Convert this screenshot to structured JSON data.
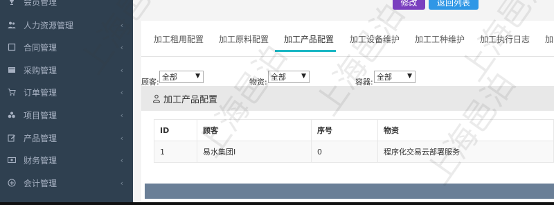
{
  "sidebar": {
    "items": [
      {
        "label": "会员管理",
        "icon": "trophy-icon"
      },
      {
        "label": "人力资源管理",
        "icon": "users-icon"
      },
      {
        "label": "合同管理",
        "icon": "contract-icon"
      },
      {
        "label": "采购管理",
        "icon": "purchase-icon"
      },
      {
        "label": "订单管理",
        "icon": "cart-icon"
      },
      {
        "label": "项目管理",
        "icon": "project-icon"
      },
      {
        "label": "产品管理",
        "icon": "edit-icon"
      },
      {
        "label": "财务管理",
        "icon": "money-icon"
      },
      {
        "label": "会计管理",
        "icon": "accounting-icon"
      }
    ],
    "chevron": "‹"
  },
  "toolbar": {
    "btn1_label": "修改",
    "btn2_label": "返回列表"
  },
  "tabs": [
    {
      "label": "加工租用配置"
    },
    {
      "label": "加工原料配置"
    },
    {
      "label": "加工产品配置",
      "active": true
    },
    {
      "label": "加工设备维护"
    },
    {
      "label": "加工工种维护"
    },
    {
      "label": "加工执行日志"
    },
    {
      "label": "加"
    }
  ],
  "filters": {
    "customer_label": "顾客:",
    "customer_value": "全部",
    "material_label": "物资:",
    "material_value": "全部",
    "container_label": "容器:",
    "container_value": "全部"
  },
  "section": {
    "title": "加工产品配置"
  },
  "table": {
    "headers": [
      "ID",
      "顾客",
      "序号",
      "物资"
    ],
    "rows": [
      [
        "1",
        "易水集团I",
        "0",
        "程序化交易云部署服务"
      ]
    ]
  },
  "watermark": {
    "text": "上海邑泊"
  },
  "colors": {
    "sidebar_bg": "#2f4050",
    "accent_teal": "#1ab7c4",
    "btn_purple": "#7a3fbf",
    "btn_blue": "#2f97e6"
  }
}
